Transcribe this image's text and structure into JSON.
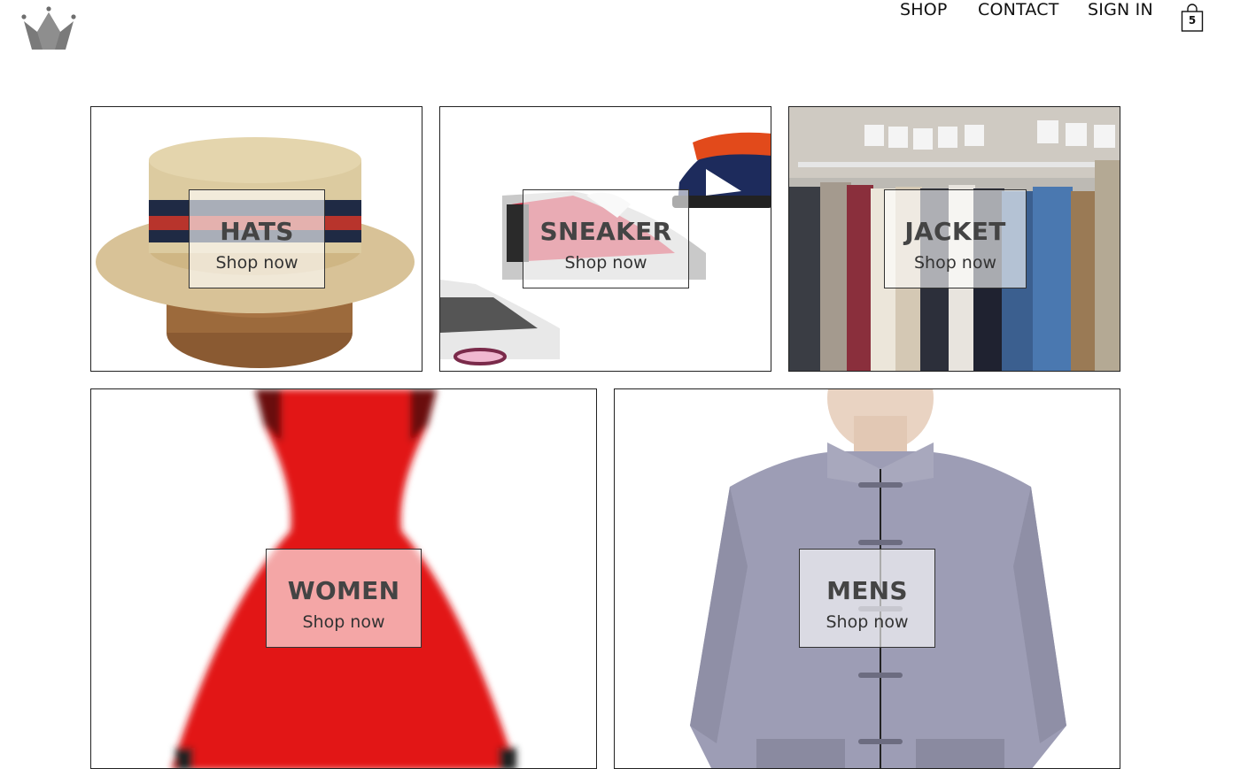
{
  "header": {
    "logo_icon": "crown-icon",
    "nav": {
      "shop": "SHOP",
      "contact": "CONTACT",
      "sign_in": "SIGN IN"
    },
    "cart": {
      "icon": "shopping-bag-icon",
      "count": "5"
    }
  },
  "categories": [
    {
      "title": "HATS",
      "cta": "Shop now"
    },
    {
      "title": "SNEAKER",
      "cta": "Shop now"
    },
    {
      "title": "JACKET",
      "cta": "Shop now"
    },
    {
      "title": "WOMEN",
      "cta": "Shop now"
    },
    {
      "title": "MENS",
      "cta": "Shop now"
    }
  ]
}
